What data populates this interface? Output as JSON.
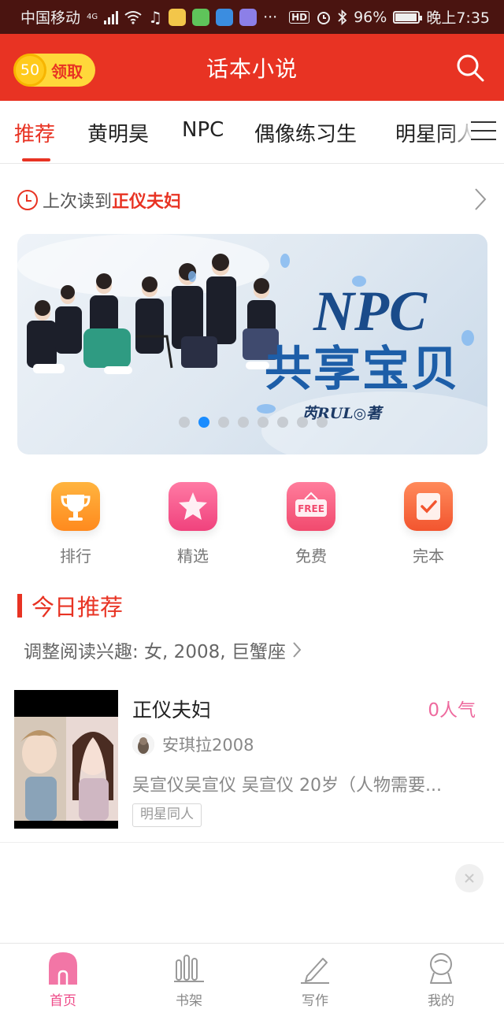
{
  "status_bar": {
    "carrier": "中国移动",
    "network": "4G",
    "battery": "96%",
    "time": "晚上7:35",
    "hd": "HD",
    "more": "···"
  },
  "header": {
    "coin_amount": "50",
    "coin_label": "领取",
    "title": "话本小说"
  },
  "tabs": [
    {
      "label": "推荐"
    },
    {
      "label": "黄明昊"
    },
    {
      "label": "NPC"
    },
    {
      "label": "偶像练习生"
    },
    {
      "label": "明星同人"
    }
  ],
  "last_read": {
    "prefix": "上次读到",
    "book": "正仪夫妇"
  },
  "banner": {
    "title": "NPC",
    "subtitle": "共享宝贝",
    "author": "芮RUL◎著",
    "slides_total": 8,
    "active_slide_index": 1
  },
  "categories": [
    {
      "label": "排行",
      "icon": "trophy-icon"
    },
    {
      "label": "精选",
      "icon": "star-icon"
    },
    {
      "label": "免费",
      "icon": "free-sign-icon"
    },
    {
      "label": "完本",
      "icon": "check-notebook-icon"
    }
  ],
  "section": {
    "title": "今日推荐",
    "interest_text": "调整阅读兴趣: 女, 2008, 巨蟹座"
  },
  "book": {
    "title": "正仪夫妇",
    "popularity": "0人气",
    "author": "安琪拉2008",
    "description": "吴宣仪吴宣仪 吴宣仪 20岁（人物需要...",
    "tag": "明星同人"
  },
  "bottom_nav": [
    {
      "label": "首页",
      "icon": "home-icon",
      "active": true
    },
    {
      "label": "书架",
      "icon": "bookshelf-icon",
      "active": false
    },
    {
      "label": "写作",
      "icon": "pen-icon",
      "active": false
    },
    {
      "label": "我的",
      "icon": "profile-icon",
      "active": false
    }
  ],
  "colors": {
    "brand_red": "#e83323",
    "accent_pink": "#ee4a88",
    "status_bar_bg": "#4a1410"
  }
}
